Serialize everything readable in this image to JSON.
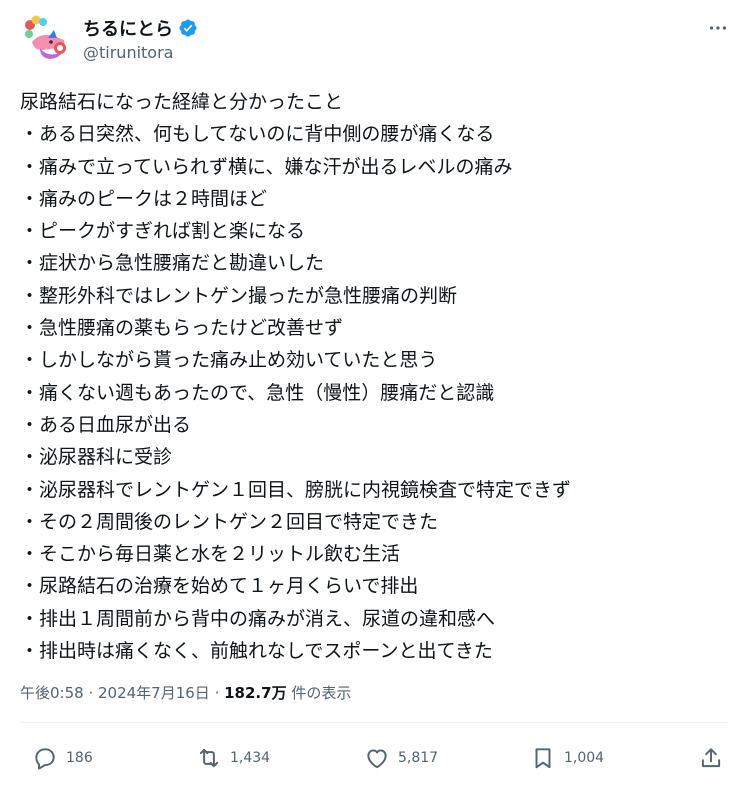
{
  "author": {
    "display_name": "ちるにとら",
    "handle": "@tirunitora",
    "verified": true
  },
  "icons": {
    "avatar": "avatar-illustration",
    "verified": "verified-badge-icon",
    "more": "more-options-icon",
    "reply": "reply-icon",
    "retweet": "retweet-icon",
    "like": "heart-icon",
    "bookmark": "bookmark-icon",
    "share": "share-icon"
  },
  "colors": {
    "verified": "#1d9bf0",
    "text": "#0f1419",
    "secondary": "#536471"
  },
  "tweet": {
    "lines": [
      "尿路結石になった経緯と分かったこと",
      "・ある日突然、何もしてないのに背中側の腰が痛くなる",
      "・痛みで立っていられず横に、嫌な汗が出るレベルの痛み",
      "・痛みのピークは２時間ほど",
      "・ピークがすぎれば割と楽になる",
      "・症状から急性腰痛だと勘違いした",
      "・整形外科ではレントゲン撮ったが急性腰痛の判断",
      "・急性腰痛の薬もらったけど改善せず",
      "・しかしながら貰った痛み止め効いていたと思う",
      "・痛くない週もあったので、急性（慢性）腰痛だと認識",
      "・ある日血尿が出る",
      "・泌尿器科に受診",
      "・泌尿器科でレントゲン１回目、膀胱に内視鏡検査で特定できず",
      "・その２周間後のレントゲン２回目で特定できた",
      "・そこから毎日薬と水を２リットル飲む生活",
      "・尿路結石の治療を始めて１ヶ月くらいで排出",
      "・排出１周間前から背中の痛みが消え、尿道の違和感へ",
      "・排出時は痛くなく、前触れなしでスポーンと出てきた"
    ]
  },
  "meta": {
    "time": "午後0:58",
    "separator": " · ",
    "date": "2024年7月16日",
    "views_count": "182.7万",
    "views_label": " 件の表示"
  },
  "stats": {
    "replies": "186",
    "retweets": "1,434",
    "likes": "5,817",
    "bookmarks": "1,004"
  }
}
